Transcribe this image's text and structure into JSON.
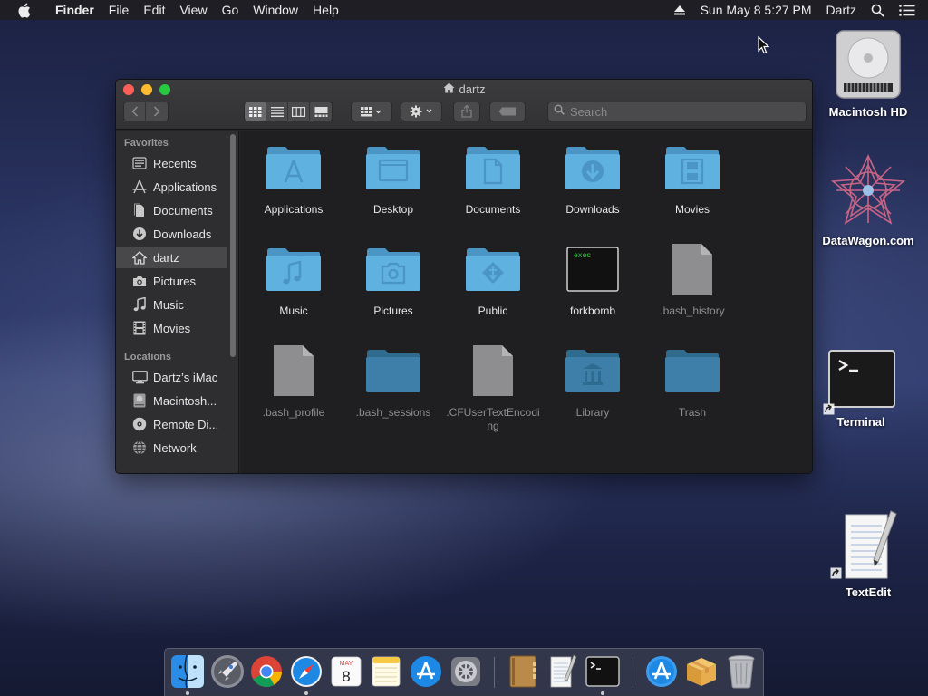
{
  "menubar": {
    "app_name": "Finder",
    "menus": [
      "File",
      "Edit",
      "View",
      "Go",
      "Window",
      "Help"
    ],
    "datetime": "Sun May 8  5:27 PM",
    "user": "Dartz"
  },
  "window": {
    "title": "dartz",
    "search_placeholder": "Search"
  },
  "sidebar": {
    "favorites_header": "Favorites",
    "favorites": [
      "Recents",
      "Applications",
      "Documents",
      "Downloads",
      "dartz",
      "Pictures",
      "Music",
      "Movies"
    ],
    "selected": "dartz",
    "locations_header": "Locations",
    "locations": [
      "Dartz’s iMac",
      "Macintosh...",
      "Remote Di...",
      "Network"
    ]
  },
  "files": [
    {
      "name": "Applications"
    },
    {
      "name": "Desktop"
    },
    {
      "name": "Documents"
    },
    {
      "name": "Downloads"
    },
    {
      "name": "Movies"
    },
    {
      "name": "Music"
    },
    {
      "name": "Pictures"
    },
    {
      "name": "Public"
    },
    {
      "name": "forkbomb",
      "badge": "exec"
    },
    {
      "name": ".bash_history"
    },
    {
      "name": ".bash_profile"
    },
    {
      "name": ".bash_sessions"
    },
    {
      "name": ".CFUserTextEncoding"
    },
    {
      "name": "Library"
    },
    {
      "name": "Trash"
    }
  ],
  "desktop": {
    "macintosh_hd": "Macintosh HD",
    "datawagon": "DataWagon.com",
    "terminal": "Terminal",
    "textedit": "TextEdit"
  },
  "dock": {
    "calendar_month": "MAY",
    "calendar_day": "8"
  },
  "colors": {
    "folder_blue": "#5fb1e0",
    "folder_dim": "#3d7fa8",
    "selected_row": "#48484a"
  }
}
